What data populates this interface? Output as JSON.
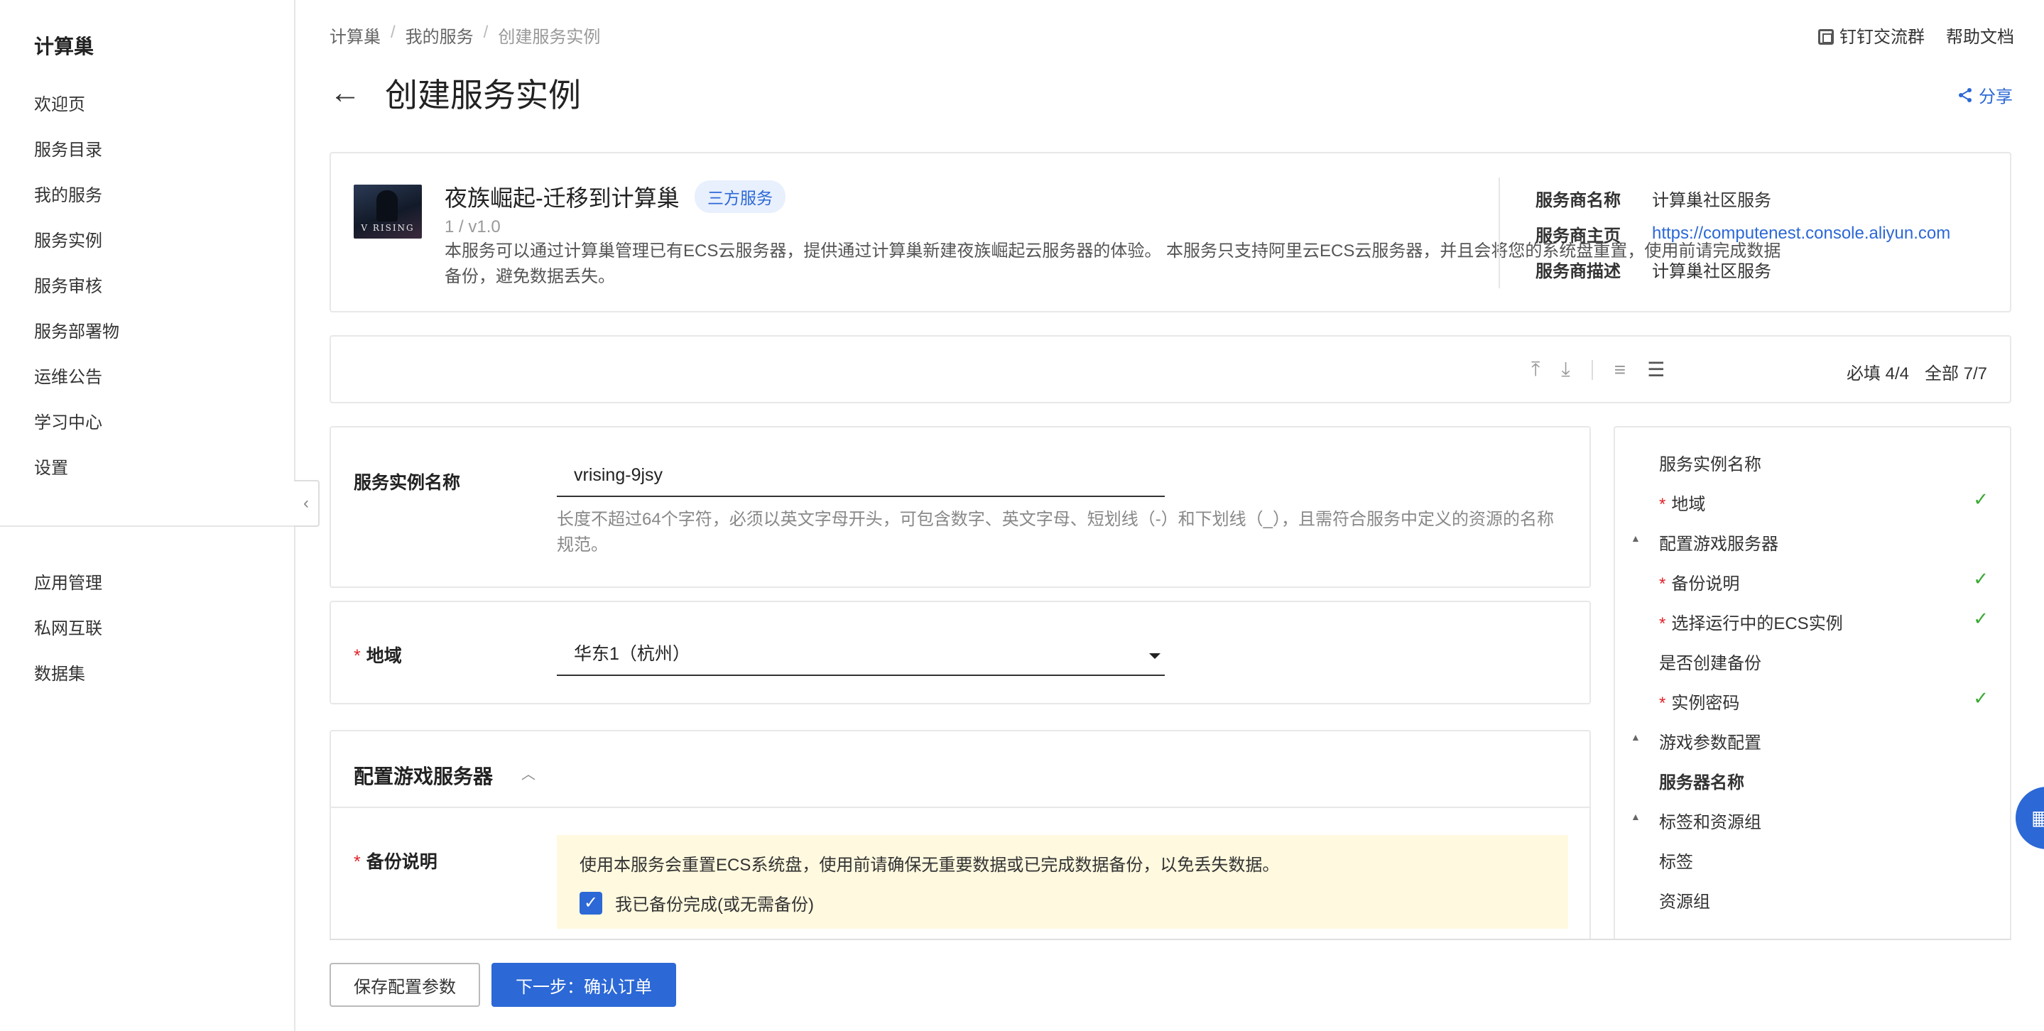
{
  "sidebar": {
    "brand": "计算巢",
    "items": [
      "欢迎页",
      "服务目录",
      "我的服务",
      "服务实例",
      "服务审核",
      "服务部署物",
      "运维公告",
      "学习中心",
      "设置"
    ],
    "items2": [
      "应用管理",
      "私网互联",
      "数据集"
    ],
    "collapse_icon": "chevron-left-icon"
  },
  "header": {
    "breadcrumb": [
      "计算巢",
      "我的服务",
      "创建服务实例"
    ],
    "top_links": [
      "钉钉交流群",
      "帮助文档"
    ],
    "title": "创建服务实例",
    "share": "分享"
  },
  "service": {
    "name": "夜族崛起-迁移到计算巢",
    "badge": "三方服务",
    "version": "1 / v1.0",
    "description": "本服务可以通过计算巢管理已有ECS云服务器，提供通过计算巢新建夜族崛起云服务器的体验。 本服务只支持阿里云ECS云服务器，并且会将您的系统盘重置，使用前请完成数据备份，避免数据丢失。",
    "logo_text": "V RISING",
    "provider": {
      "name_label": "服务商名称",
      "name_value": "计算巢社区服务",
      "home_label": "服务商主页",
      "home_value": "https://computenest.console.aliyun.com",
      "desc_label": "服务商描述",
      "desc_value": "计算巢社区服务"
    }
  },
  "toolbar": {
    "required": "必填 4/4",
    "total": "全部 7/7",
    "icons": [
      "to-top-icon",
      "download-icon",
      "wrap-icon",
      "list-icon"
    ]
  },
  "form": {
    "instance_name": {
      "label": "服务实例名称",
      "value": "vrising-9jsy",
      "hint": "长度不超过64个字符，必须以英文字母开头，可包含数字、英文字母、短划线（-）和下划线（_），且需符合服务中定义的资源的名称规范。"
    },
    "region": {
      "required": "*",
      "label": "地域",
      "value": "华东1（杭州）"
    },
    "game_section": {
      "title": "配置游戏服务器",
      "backup_label": "备份说明",
      "notice": "使用本服务会重置ECS系统盘，使用前请确保无重要数据或已完成数据备份，以免丢失数据。",
      "checkbox_label": "我已备份完成(或无需备份)",
      "checkbox_checked": true
    }
  },
  "outline": [
    {
      "label": "服务实例名称",
      "required": false,
      "checked": false,
      "toggle": false,
      "bold": false
    },
    {
      "label": "地域",
      "required": true,
      "checked": true,
      "toggle": false,
      "bold": false
    },
    {
      "label": "配置游戏服务器",
      "required": false,
      "checked": false,
      "toggle": true,
      "bold": false
    },
    {
      "label": "备份说明",
      "required": true,
      "checked": true,
      "toggle": false,
      "bold": false
    },
    {
      "label": "选择运行中的ECS实例",
      "required": true,
      "checked": true,
      "toggle": false,
      "bold": false
    },
    {
      "label": "是否创建备份",
      "required": false,
      "checked": false,
      "toggle": false,
      "bold": false
    },
    {
      "label": "实例密码",
      "required": true,
      "checked": true,
      "toggle": false,
      "bold": false
    },
    {
      "label": "游戏参数配置",
      "required": false,
      "checked": false,
      "toggle": true,
      "bold": false
    },
    {
      "label": "服务器名称",
      "required": false,
      "checked": false,
      "toggle": false,
      "bold": true
    },
    {
      "label": "标签和资源组",
      "required": false,
      "checked": false,
      "toggle": true,
      "bold": false
    },
    {
      "label": "标签",
      "required": false,
      "checked": false,
      "toggle": false,
      "bold": false
    },
    {
      "label": "资源组",
      "required": false,
      "checked": false,
      "toggle": false,
      "bold": false
    }
  ],
  "footer": {
    "save_label": "保存配置参数",
    "next_label": "下一步：确认订单"
  },
  "colors": {
    "accent": "#2c68d6",
    "required": "#e0242a",
    "check": "#3aaa35",
    "notice_bg": "#fff9df"
  }
}
